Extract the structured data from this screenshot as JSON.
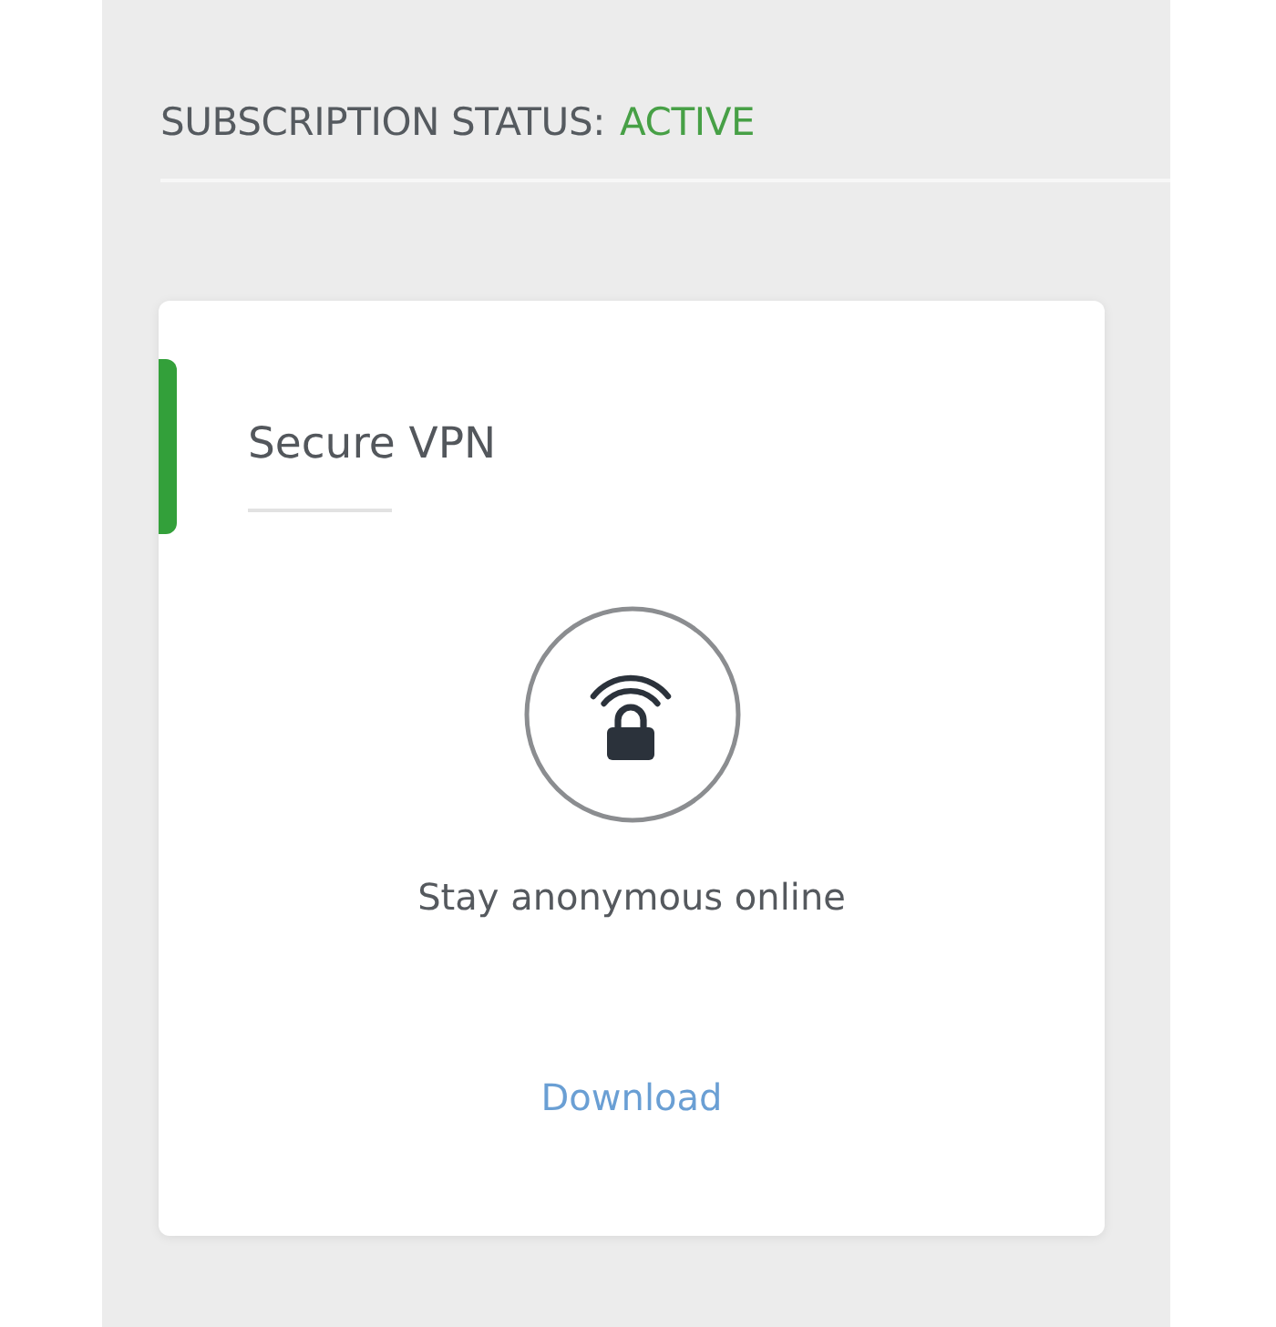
{
  "subscription": {
    "label": "SUBSCRIPTION STATUS:",
    "value": "ACTIVE"
  },
  "products": [
    {
      "title": "Secure VPN",
      "highlighted": true,
      "description": "Stay anonymous online",
      "action": "Download"
    }
  ]
}
